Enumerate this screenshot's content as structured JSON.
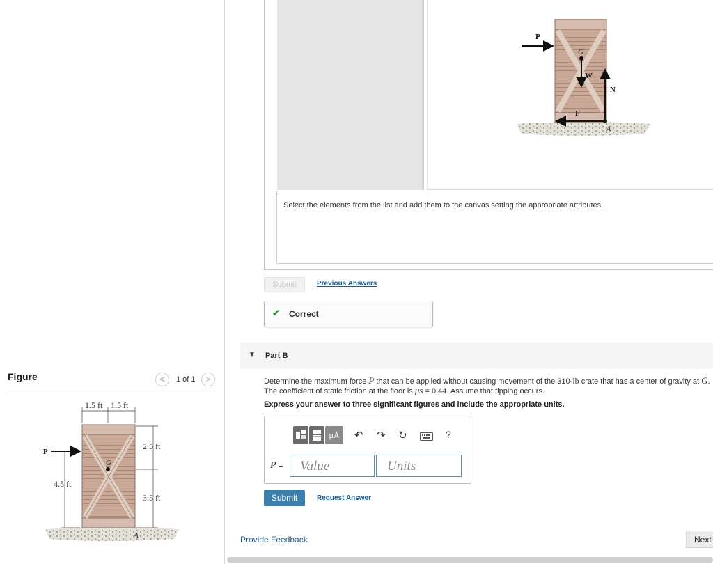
{
  "figure_panel": {
    "title": "Figure",
    "pager": "1 of 1",
    "prev_symbol": "<",
    "next_symbol": ">",
    "labels": {
      "dim_top_left": "1.5 ft",
      "dim_top_right": "1.5 ft",
      "dim_right_upper": "2.5 ft",
      "dim_right_lower": "3.5 ft",
      "dim_left": "4.5 ft",
      "force_p": "P",
      "center_g": "G",
      "point_a": "A"
    }
  },
  "part_a": {
    "instruction": "Select the elements from the list and add them to the canvas setting the appropriate attributes.",
    "fbd_labels": {
      "p": "P",
      "g": "G",
      "w": "W",
      "n": "N",
      "f": "F",
      "a": "A"
    },
    "submit_label": "Submit",
    "previous_answers_label": "Previous Answers",
    "feedback_label": "Correct"
  },
  "part_b": {
    "title": "Part B",
    "question_line1_pre": "Determine the maximum force ",
    "question_var_p": "P",
    "question_line1_mid": " that can be applied without causing movement of the 310-",
    "question_unit_lb": "lb",
    "question_line1_post": " crate that has a center of gravity at ",
    "question_var_g": "G",
    "question_line1_end": ".",
    "question_line2_pre": "The coefficient of static friction at the floor is ",
    "question_mu": "μs",
    "question_line2_post": " = 0.44. Assume that tipping occurs.",
    "instruction": "Express your answer to three significant figures and include the appropriate units.",
    "answer_label": "P =",
    "value_placeholder": "Value",
    "units_placeholder": "Units",
    "toolbar": {
      "units_symbol": "μÅ",
      "undo_symbol": "↶",
      "redo_symbol": "↷",
      "reset_symbol": "↻",
      "help_symbol": "?"
    },
    "submit_label": "Submit",
    "request_answer_label": "Request Answer"
  },
  "footer": {
    "provide_feedback": "Provide Feedback",
    "next_label": "Next"
  }
}
